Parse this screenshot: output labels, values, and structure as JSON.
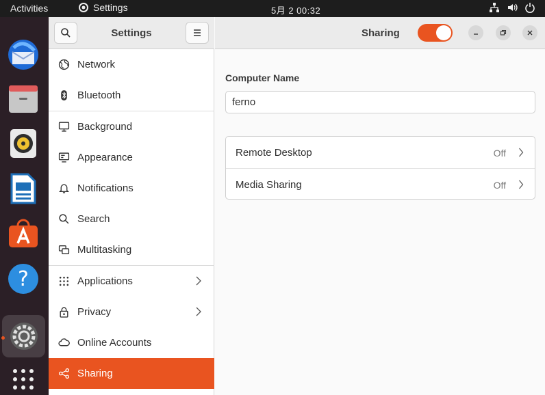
{
  "topbar": {
    "activities": "Activities",
    "app_name": "Settings",
    "clock": "5月 2  00:32"
  },
  "dock": {
    "items": [
      "thunderbird",
      "files",
      "rhythmbox",
      "libreoffice-writer",
      "app-center",
      "help",
      "settings",
      "show-apps"
    ]
  },
  "sidebar": {
    "title": "Settings",
    "items": [
      {
        "label": "Network"
      },
      {
        "label": "Bluetooth"
      },
      {
        "label": "Background"
      },
      {
        "label": "Appearance"
      },
      {
        "label": "Notifications"
      },
      {
        "label": "Search"
      },
      {
        "label": "Multitasking"
      },
      {
        "label": "Applications"
      },
      {
        "label": "Privacy"
      },
      {
        "label": "Online Accounts"
      },
      {
        "label": "Sharing"
      }
    ],
    "selected": "Sharing"
  },
  "header": {
    "title": "Sharing",
    "toggle_on": true
  },
  "sharing": {
    "computer_name_label": "Computer Name",
    "computer_name_value": "ferno",
    "rows": [
      {
        "label": "Remote Desktop",
        "value": "Off"
      },
      {
        "label": "Media Sharing",
        "value": "Off"
      }
    ]
  },
  "colors": {
    "accent": "#e95420",
    "dock_bg": "#2b1f26",
    "topbar_bg": "#1d1d1d"
  }
}
